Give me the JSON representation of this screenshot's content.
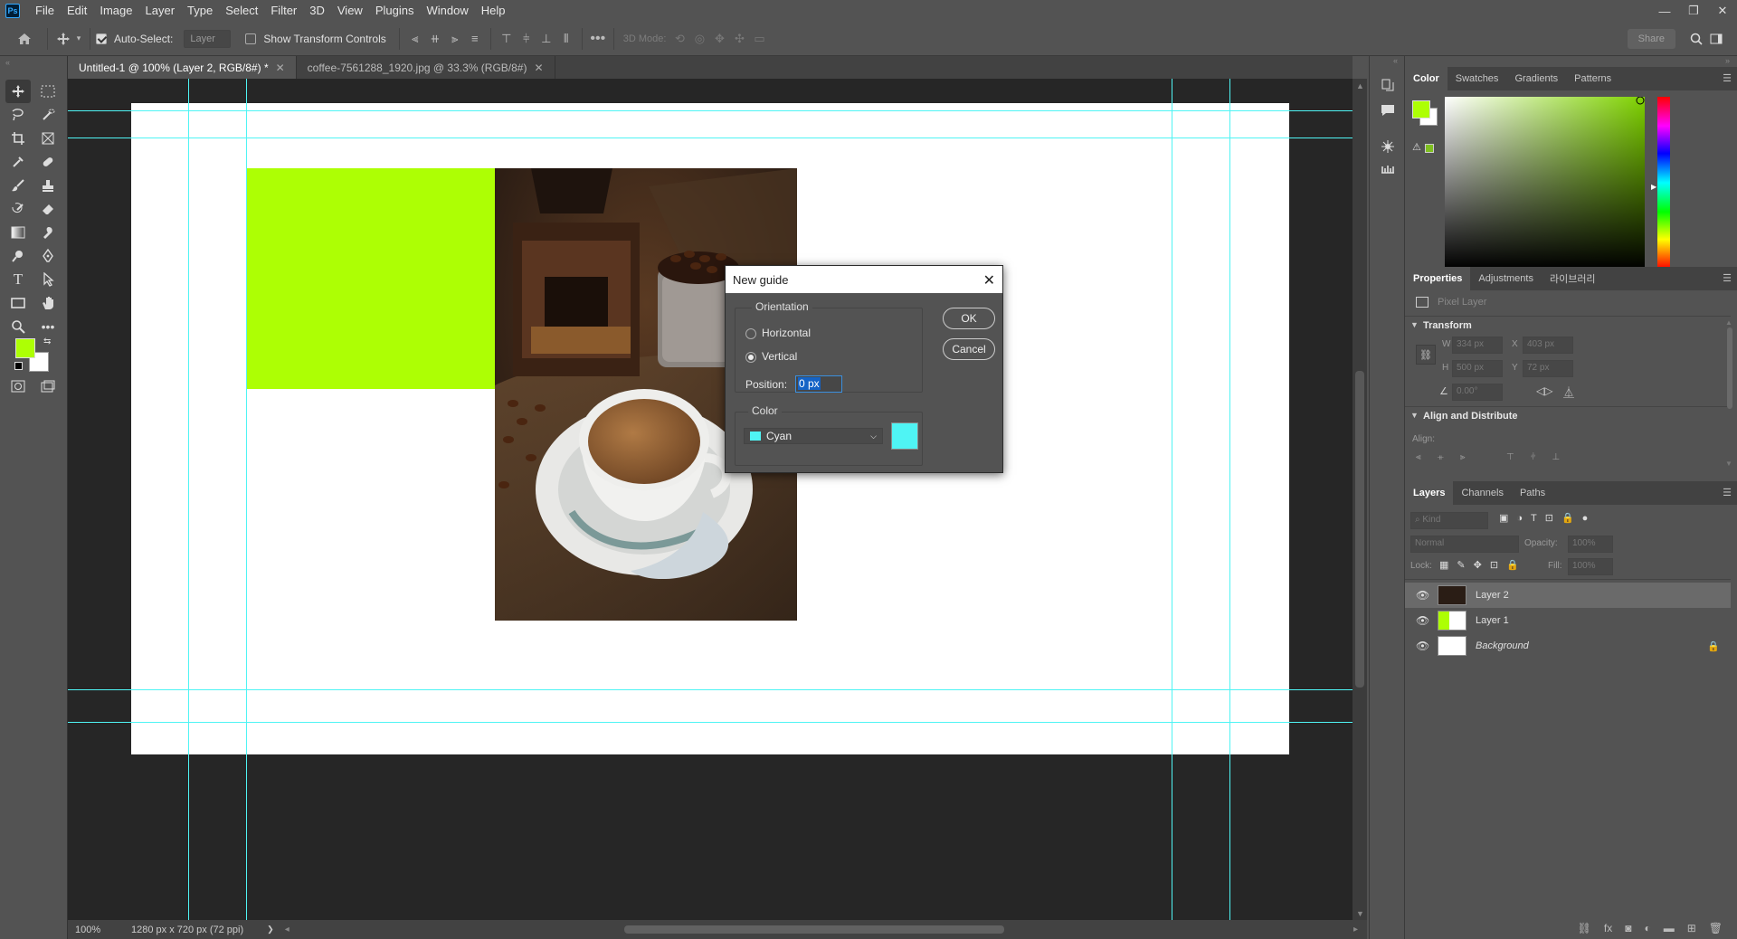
{
  "menubar": {
    "logo": "Ps",
    "items": [
      "File",
      "Edit",
      "Image",
      "Layer",
      "Type",
      "Select",
      "Filter",
      "3D",
      "View",
      "Plugins",
      "Window",
      "Help"
    ]
  },
  "optionsbar": {
    "auto_select_label": "Auto-Select:",
    "auto_select_checked": true,
    "auto_select_target": "Layer",
    "show_transform_label": "Show Transform Controls",
    "show_transform_checked": false,
    "mode_3d_label": "3D Mode:",
    "share_label": "Share"
  },
  "tabs": [
    {
      "label": "Untitled-1 @ 100% (Layer 2, RGB/8#) *",
      "active": true
    },
    {
      "label": "coffee-7561288_1920.jpg @ 33.3% (RGB/8#)",
      "active": false
    }
  ],
  "canvas": {
    "green_color": "#adff04",
    "guide_color": "#4ff4f4"
  },
  "status": {
    "zoom": "100%",
    "doc_info": "1280 px x 720 px (72 ppi)",
    "arrow": "❯"
  },
  "tools": {
    "foreground_color": "#adff04",
    "background_color": "#ffffff"
  },
  "color_panel": {
    "tabs": [
      "Color",
      "Swatches",
      "Gradients",
      "Patterns"
    ],
    "active_tab": "Color",
    "hue_color": "#7fd200"
  },
  "properties_panel": {
    "tabs": [
      "Properties",
      "Adjustments",
      "라이브러리"
    ],
    "layer_type": "Pixel Layer",
    "transform_title": "Transform",
    "w_label": "W",
    "w": "334 px",
    "x_label": "X",
    "x": "403 px",
    "h_label": "H",
    "h": "500 px",
    "y_label": "Y",
    "y": "72 px",
    "angle": "0.00°",
    "align_title": "Align and Distribute",
    "align_label": "Align:"
  },
  "layers_panel": {
    "tabs": [
      "Layers",
      "Channels",
      "Paths"
    ],
    "kind_label": "Kind",
    "blend_mode": "Normal",
    "opacity_label": "Opacity:",
    "opacity": "100%",
    "lock_label": "Lock:",
    "fill_label": "Fill:",
    "fill": "100%",
    "layers": [
      {
        "name": "Layer 2",
        "selected": true
      },
      {
        "name": "Layer 1",
        "selected": false
      },
      {
        "name": "Background",
        "selected": false
      }
    ]
  },
  "dialog": {
    "title": "New guide",
    "orientation_label": "Orientation",
    "horizontal_label": "Horizontal",
    "vertical_label": "Vertical",
    "vertical_selected": true,
    "position_label": "Position:",
    "position_value": "0 px",
    "color_label": "Color",
    "color_name": "Cyan",
    "color_swatch": "#4ff4f4",
    "ok_label": "OK",
    "cancel_label": "Cancel"
  }
}
